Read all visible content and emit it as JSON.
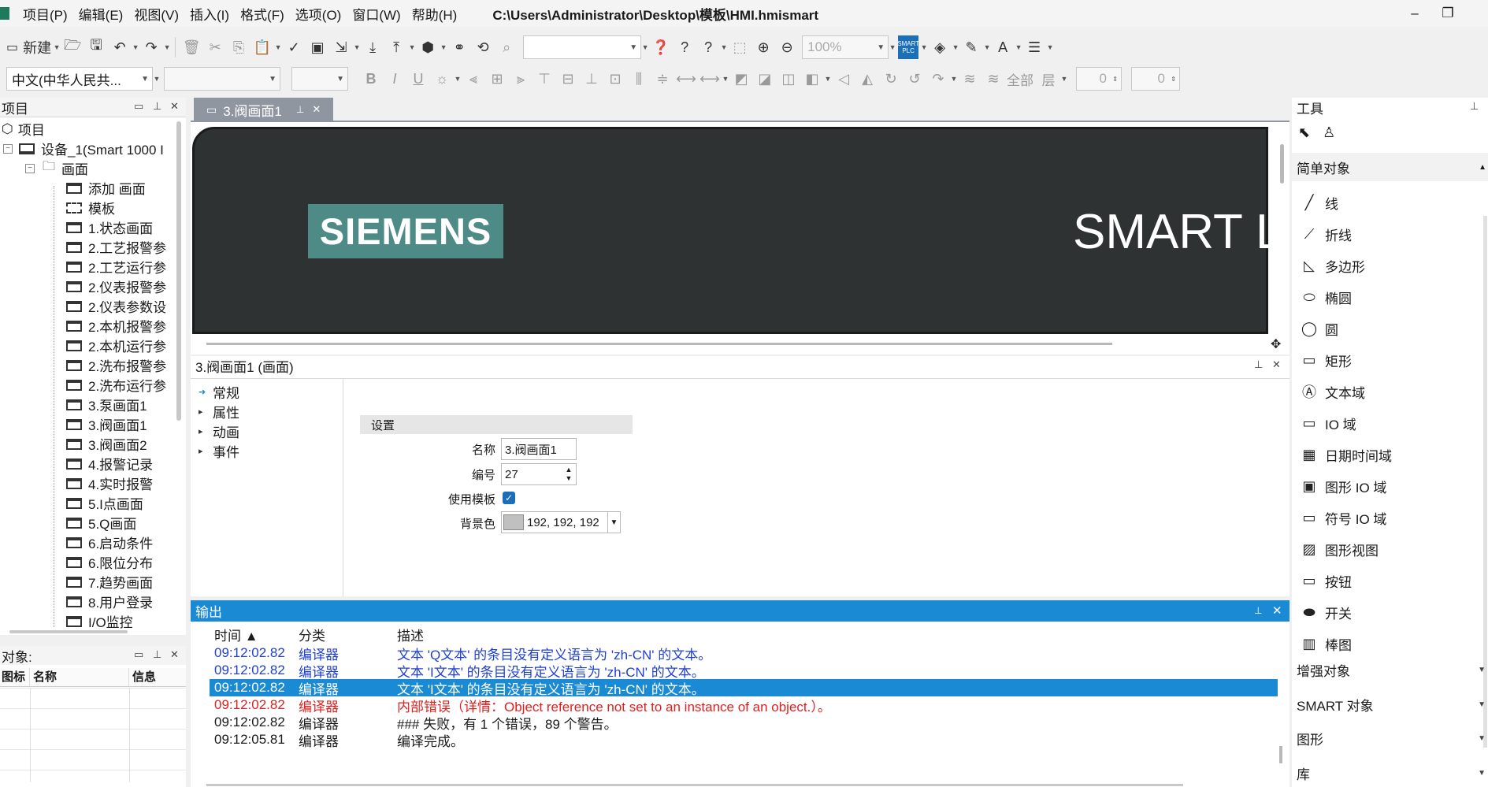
{
  "window": {
    "path": "C:\\Users\\Administrator\\Desktop\\模板\\HMI.hmismart",
    "controls": [
      "–",
      "❐"
    ]
  },
  "menu": [
    "项目(P)",
    "编辑(E)",
    "视图(V)",
    "插入(I)",
    "格式(F)",
    "选项(O)",
    "窗口(W)",
    "帮助(H)"
  ],
  "toolbar1": {
    "new_label": "新建",
    "zoom_value": "100%",
    "plc_badge": "SMART PLC"
  },
  "toolbar2": {
    "language": "中文(中华人民共...",
    "font_bold": "B",
    "font_italic": "I",
    "font_underline": "U",
    "all_label": "全部",
    "layer_label": "层",
    "layer_value_1": "0",
    "layer_value_2": "0"
  },
  "project_panel": {
    "title": "项目",
    "root": "项目",
    "device": "设备_1(Smart 1000 I",
    "screens_folder": "画面",
    "items": [
      "添加 画面",
      "模板",
      "1.状态画面",
      "2.工艺报警参",
      "2.工艺运行参",
      "2.仪表报警参",
      "2.仪表参数设",
      "2.本机报警参",
      "2.本机运行参",
      "2.洗布报警参",
      "2.洗布运行参",
      "3.泵画面1",
      "3.阀画面1",
      "3.阀画面2",
      "4.报警记录",
      "4.实时报警",
      "5.I点画面",
      "5.Q画面",
      "6.启动条件",
      "6.限位分布",
      "7.趋势画面",
      "8.用户登录",
      "I/O监控"
    ]
  },
  "objects_panel": {
    "title": "对象:",
    "columns": [
      "图标",
      "名称",
      "信息"
    ]
  },
  "doc_tab": {
    "label": "3.阀画面1"
  },
  "hmi": {
    "logo_text": "SIEMENS",
    "header_text": "SMART LI"
  },
  "properties": {
    "title": "3.阀画面1 (画面)",
    "nav": [
      "常规",
      "属性",
      "动画",
      "事件"
    ],
    "section": "设置",
    "name_label": "名称",
    "name_value": "3.阀画面1",
    "number_label": "编号",
    "number_value": "27",
    "template_label": "使用模板",
    "template_checked": true,
    "bg_label": "背景色",
    "bg_value": "192, 192, 192",
    "bg_color": "#c0c0c0"
  },
  "output": {
    "title": "输出",
    "columns": [
      "时间 ▲",
      "分类",
      "描述"
    ],
    "rows": [
      {
        "time": "09:12:02.82",
        "category": "编译器",
        "desc": "文本 'Q文本' 的条目没有定义语言为 'zh-CN' 的文本。",
        "kind": "warning"
      },
      {
        "time": "09:12:02.82",
        "category": "编译器",
        "desc": "文本 'I文本' 的条目没有定义语言为 'zh-CN' 的文本。",
        "kind": "warning"
      },
      {
        "time": "09:12:02.82",
        "category": "编译器",
        "desc": "文本 'I文本' 的条目没有定义语言为 'zh-CN' 的文本。",
        "kind": "selected"
      },
      {
        "time": "09:12:02.82",
        "category": "编译器",
        "desc": "内部错误（详情：Object reference not set to an instance of an object.）。",
        "kind": "error"
      },
      {
        "time": "09:12:02.82",
        "category": "编译器",
        "desc": "### 失败，有 1 个错误，89 个警告。",
        "kind": "normal"
      },
      {
        "time": "09:12:05.81",
        "category": "编译器",
        "desc": "编译完成。",
        "kind": "normal"
      }
    ]
  },
  "tools": {
    "title": "工具",
    "simple_objects": "简单对象",
    "items": [
      "线",
      "折线",
      "多边形",
      "椭圆",
      "圆",
      "矩形",
      "文本域",
      "IO 域",
      "日期时间域",
      "图形 IO 域",
      "符号 IO 域",
      "图形视图",
      "按钮",
      "开关",
      "棒图"
    ],
    "categories": [
      "增强对象",
      "SMART 对象",
      "图形",
      "库"
    ]
  },
  "colors": {
    "accent": "#1a8ad4",
    "warning_text": "#1f3fd1",
    "error_text": "#e02020",
    "selected_row": "#1a8ad4"
  }
}
